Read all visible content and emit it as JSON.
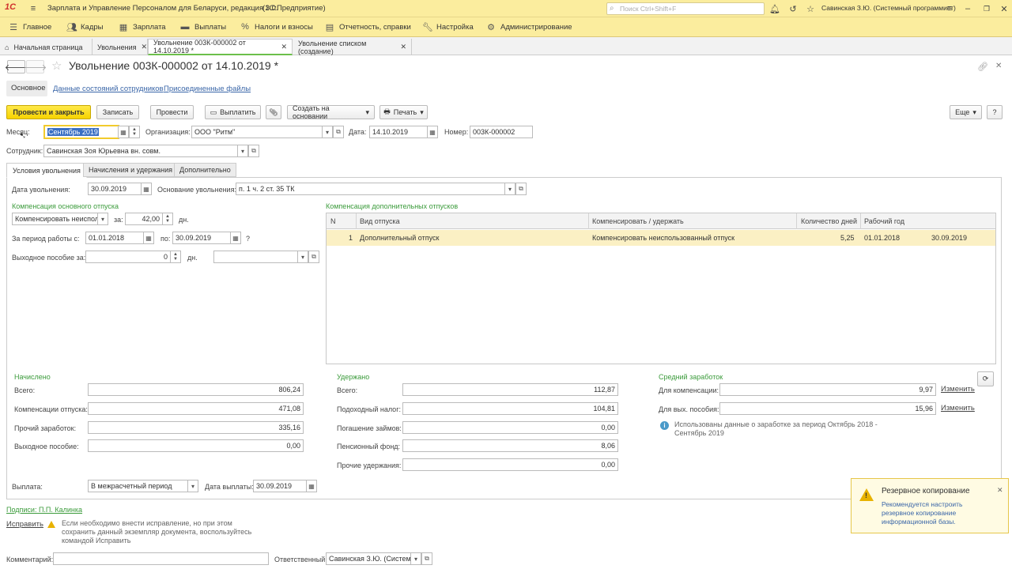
{
  "app": {
    "logo": "1С",
    "title": "Зарплата и Управление Персоналом для Беларуси, редакция 3.0.",
    "platform": "(1С:Предприятие)",
    "search_placeholder": "Поиск Ctrl+Shift+F",
    "user": "Савинская З.Ю. (Системный программист)"
  },
  "menu": [
    {
      "label": "Главное",
      "icon": "menu-lines-icon"
    },
    {
      "label": "Кадры",
      "icon": "people-icon"
    },
    {
      "label": "Зарплата",
      "icon": "calculator-icon"
    },
    {
      "label": "Выплаты",
      "icon": "wallet-icon"
    },
    {
      "label": "Налоги и взносы",
      "icon": "percent-icon"
    },
    {
      "label": "Отчетность, справки",
      "icon": "report-icon"
    },
    {
      "label": "Настройка",
      "icon": "wrench-icon"
    },
    {
      "label": "Администрирование",
      "icon": "gear-icon"
    }
  ],
  "tabs": [
    {
      "label": "Начальная страница"
    },
    {
      "label": "Увольнения"
    },
    {
      "label": "Увольнение 003К-000002 от 14.10.2019 *"
    },
    {
      "label": "Увольнение списком (создание)"
    }
  ],
  "document": {
    "title": "Увольнение 003К-000002 от 14.10.2019 *",
    "subnav": [
      "Основное",
      "Данные состояний сотрудников",
      "Присоединенные файлы"
    ],
    "toolbar": {
      "post_close": "Провести и закрыть",
      "save": "Записать",
      "post": "Провести",
      "pay": "Выплатить",
      "create_based": "Создать на основании",
      "print": "Печать",
      "more": "Еще",
      "help": "?"
    },
    "header": {
      "month_label": "Месяц:",
      "month_value": "Сентябрь 2019",
      "org_label": "Организация:",
      "org_value": "ООО \"Ритм\"",
      "date_label": "Дата:",
      "date_value": "14.10.2019",
      "number_label": "Номер:",
      "number_value": "003К-000002",
      "employee_label": "Сотрудник:",
      "employee_value": "Савинская Зоя Юрьевна вн. совм."
    },
    "form_tabs": [
      "Условия увольнения",
      "Начисления и удержания",
      "Дополнительно"
    ],
    "conditions": {
      "dismissal_date_label": "Дата увольнения:",
      "dismissal_date": "30.09.2019",
      "basis_label": "Основание увольнения:",
      "basis_value": "п. 1 ч. 2 ст. 35 ТК",
      "main_comp_title": "Компенсация основного отпуска",
      "comp_mode": "Компенсировать неиспользованный",
      "for_label": "за:",
      "days_value": "42,00",
      "days_label": "дн.",
      "period_label": "За период работы с:",
      "period_from": "01.01.2018",
      "period_to_label": "по:",
      "period_to": "30.09.2019",
      "period_help": "?",
      "severance_label": "Выходное пособие за:",
      "severance_value": "0",
      "severance_days_label": "дн."
    },
    "extra_comp": {
      "title": "Компенсация дополнительных отпусков",
      "columns": [
        "N",
        "Вид отпуска",
        "Компенсировать / удержать",
        "Количество дней",
        "Рабочий год"
      ],
      "rows": [
        {
          "n": "1",
          "kind": "Дополнительный отпуск",
          "action": "Компенсировать неиспользованный отпуск",
          "days": "5,25",
          "from": "01.01.2018",
          "to": "30.09.2019"
        }
      ]
    },
    "accrued": {
      "title": "Начислено",
      "rows": [
        {
          "label": "Всего:",
          "value": "806,24"
        },
        {
          "label": "Компенсации отпуска:",
          "value": "471,08"
        },
        {
          "label": "Прочий заработок:",
          "value": "335,16"
        },
        {
          "label": "Выходное пособие:",
          "value": "0,00"
        }
      ]
    },
    "withheld": {
      "title": "Удержано",
      "rows": [
        {
          "label": "Всего:",
          "value": "112,87"
        },
        {
          "label": "Подоходный налог:",
          "value": "104,81"
        },
        {
          "label": "Погашение займов:",
          "value": "0,00"
        },
        {
          "label": "Пенсионный фонд:",
          "value": "8,06"
        },
        {
          "label": "Прочие удержания:",
          "value": "0,00"
        }
      ]
    },
    "avg_earnings": {
      "title": "Средний заработок",
      "comp_label": "Для компенсации:",
      "comp_value": "9,97",
      "sev_label": "Для вых. пособия:",
      "sev_value": "15,96",
      "change_link": "Изменить",
      "info": "Использованы данные о заработке за период Октябрь 2018 - Сентябрь 2019"
    },
    "payment": {
      "label": "Выплата:",
      "value": "В межрасчетный период",
      "date_label": "Дата выплаты:",
      "date_value": "30.09.2019"
    },
    "signatures_link": "Подписи: П.П. Калинка",
    "correct_link": "Исправить",
    "correct_hint": "Если необходимо внести исправление, но при этом сохранить данный экземпляр документа, воспользуйтесь командой Исправить",
    "comment_label": "Комментарий:",
    "responsible_label": "Ответственный:",
    "responsible_value": "Савинская З.Ю. (Системный программист)"
  },
  "notification": {
    "title": "Резервное копирование",
    "text": "Рекомендуется настроить резервное копирование информационной базы."
  }
}
